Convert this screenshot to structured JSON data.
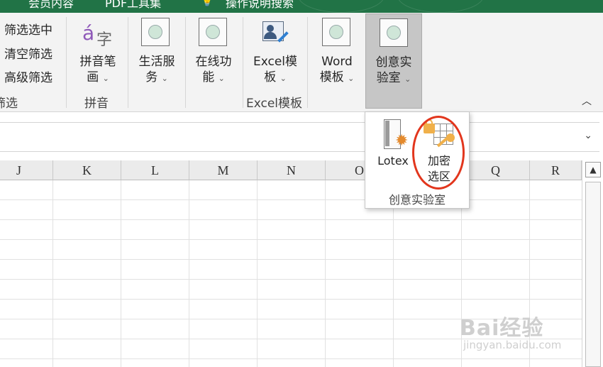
{
  "titlebar": {
    "items": [
      "会员内容",
      "PDF工具集",
      "操作说明搜索"
    ]
  },
  "ribbon": {
    "sort_filter": {
      "commands": [
        "筛选选中",
        "清空筛选",
        "高级筛选"
      ],
      "group_label": "筛选"
    },
    "pinyin": {
      "button_line1": "拼音笔",
      "button_line2": "画",
      "group_label": "拼音",
      "icon_glyph_a": "á",
      "icon_glyph_b": "字"
    },
    "life_service": {
      "line1": "生活服",
      "line2": "务"
    },
    "online": {
      "line1": "在线功",
      "line2": "能"
    },
    "excel_template": {
      "line1": "Excel模",
      "line2": "板",
      "group_label": "Excel模板"
    },
    "word_template": {
      "line1": "Word",
      "line2": "模板"
    },
    "creative_lab": {
      "line1": "创意实",
      "line2": "验室"
    },
    "collapse_glyph": "︿",
    "chevron": "⌄"
  },
  "formula_bar": {
    "expand_glyph": "⌄"
  },
  "sheet": {
    "columns": [
      "J",
      "K",
      "L",
      "M",
      "N",
      "O",
      "P",
      "Q",
      "R"
    ]
  },
  "scrollbar": {
    "up_glyph": "▲"
  },
  "dropdown": {
    "lotex_label": "Lotex",
    "encrypt_line1": "加密",
    "encrypt_line2": "选区",
    "group_label": "创意实验室"
  },
  "watermark": {
    "brand": "Bai经验",
    "url": "jingyan.baidu.com"
  },
  "colors": {
    "title_green": "#217346",
    "ribbon_bg": "#f3f3f3",
    "active_button": "#c6c6c6",
    "highlight_ring": "#e2361d"
  }
}
